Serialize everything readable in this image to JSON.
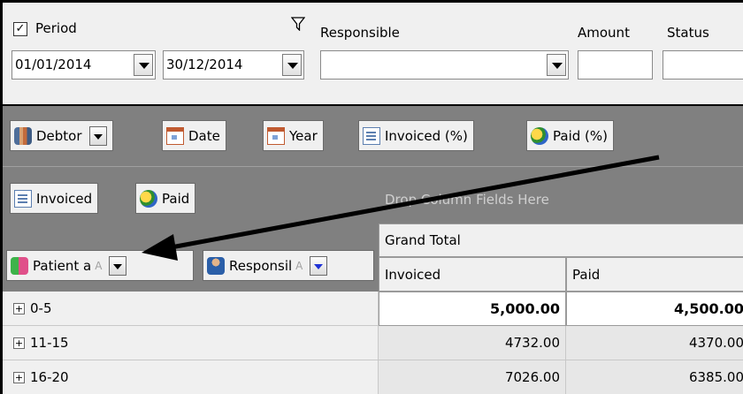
{
  "filters": {
    "period_label": "Period",
    "period_checked": "✓",
    "period_from": "01/01/2014",
    "period_to": "30/12/2014",
    "responsible_label": "Responsible",
    "responsible_value": "",
    "amount_label": "Amount",
    "amount_value": "",
    "status_label": "Status",
    "status_value": ""
  },
  "filter_fields": [
    {
      "label": "Debtor",
      "icon": "debtor-group-icon"
    },
    {
      "label": "Date",
      "icon": "calendar-icon"
    },
    {
      "label": "Year",
      "icon": "calendar-icon"
    },
    {
      "label": "Invoiced (%)",
      "icon": "document-icon"
    },
    {
      "label": "Paid (%)",
      "icon": "money-icon"
    }
  ],
  "data_fields": [
    {
      "label": "Invoiced",
      "icon": "document-icon"
    },
    {
      "label": "Paid",
      "icon": "money-icon"
    }
  ],
  "column_drop_hint": "Drop Column Fields Here",
  "row_fields": [
    {
      "label": "Patient a",
      "sort": "A",
      "icon": "patient-age-icon"
    },
    {
      "label": "Responsil",
      "sort": "A",
      "icon": "responsible-icon"
    }
  ],
  "grid": {
    "grand_total_header": "Grand Total",
    "columns": [
      "Invoiced",
      "Paid"
    ],
    "rows": [
      {
        "label": "0-5",
        "expander": "+",
        "invoiced": "5,000.00",
        "paid": "4,500.00"
      },
      {
        "label": "11-15",
        "expander": "+",
        "invoiced": "4732.00",
        "paid": "4370.00"
      },
      {
        "label": "16-20",
        "expander": "+",
        "invoiced": "7026.00",
        "paid": "6385.00"
      }
    ]
  }
}
